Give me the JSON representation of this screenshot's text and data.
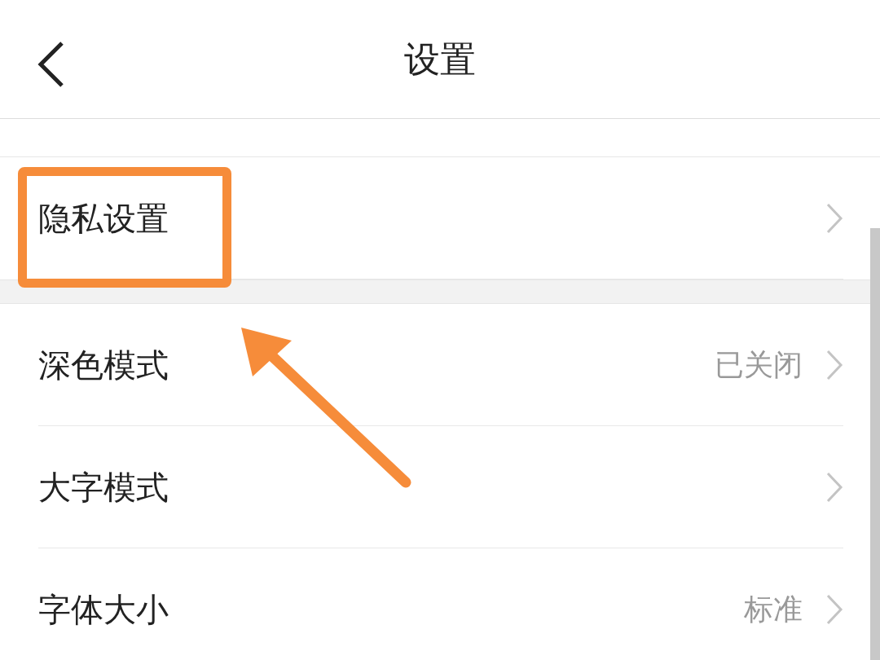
{
  "header": {
    "title": "设置"
  },
  "sections": [
    {
      "items": [
        {
          "label": "隐私设置",
          "highlighted": true
        }
      ]
    },
    {
      "items": [
        {
          "label": "深色模式",
          "value": "已关闭",
          "highlighted": false
        },
        {
          "label": "大字模式",
          "highlighted": false
        },
        {
          "label": "字体大小",
          "value": "标准",
          "highlighted": false
        }
      ]
    }
  ]
}
